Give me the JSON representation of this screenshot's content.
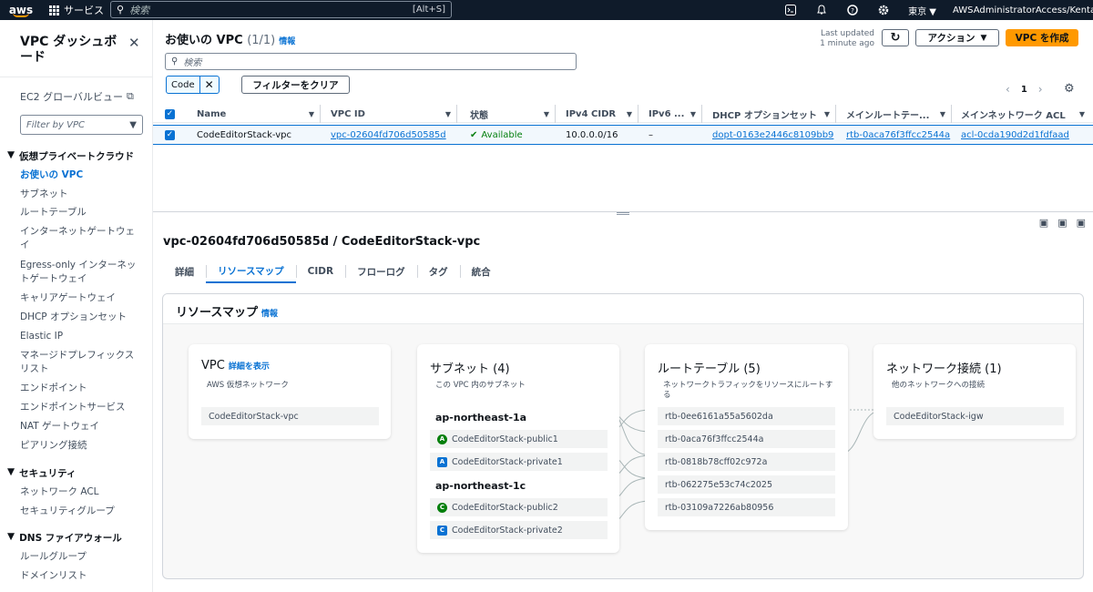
{
  "nav": {
    "logo": "aws",
    "services": "サービス",
    "search_placeholder": "検索",
    "search_shortcut": "[Alt+S]",
    "region": "東京",
    "account": "AWSAdministratorAccess/KentarouTakahashi"
  },
  "sidebar": {
    "title": "VPC ダッシュボード",
    "ec2_link": "EC2 グローバルビュー",
    "filter_placeholder": "Filter by VPC",
    "sections": [
      {
        "label": "仮想プライベートクラウド",
        "items": [
          "お使いの VPC",
          "サブネット",
          "ルートテーブル",
          "インターネットゲートウェイ",
          "Egress-only インターネットゲートウェイ",
          "キャリアゲートウェイ",
          "DHCP オプションセット",
          "Elastic IP",
          "マネージドプレフィックスリスト",
          "エンドポイント",
          "エンドポイントサービス",
          "NAT ゲートウェイ",
          "ピアリング接続"
        ]
      },
      {
        "label": "セキュリティ",
        "items": [
          "ネットワーク ACL",
          "セキュリティグループ"
        ]
      },
      {
        "label": "DNS ファイアウォール",
        "items": [
          "ルールグループ",
          "ドメインリスト"
        ]
      }
    ]
  },
  "table": {
    "title": "お使いの VPC",
    "count": "(1/1)",
    "info": "情報",
    "last_updated_label": "Last updated",
    "last_updated_value": "1 minute ago",
    "actions_label": "アクション",
    "create_label": "VPC を作成",
    "search_placeholder": "検索",
    "filter_token": "Code",
    "clear_filters": "フィルターをクリア",
    "page": "1",
    "columns": [
      "Name",
      "VPC ID",
      "状態",
      "IPv4 CIDR",
      "IPv6 ...",
      "DHCP オプションセット",
      "メインルートテー...",
      "メインネットワーク ACL"
    ],
    "row": {
      "name": "CodeEditorStack-vpc",
      "vpc_id": "vpc-02604fd706d50585d",
      "state": "Available",
      "ipv4": "10.0.0.0/16",
      "ipv6": "–",
      "dhcp": "dopt-0163e2446c8109bb9",
      "rtb": "rtb-0aca76f3ffcc2544a",
      "acl": "acl-0cda190d2d1fdfaad"
    }
  },
  "detail": {
    "title": "vpc-02604fd706d50585d / CodeEditorStack-vpc",
    "tabs": [
      "詳細",
      "リソースマップ",
      "CIDR",
      "フローログ",
      "タグ",
      "統合"
    ],
    "map_title": "リソースマップ",
    "map_info": "情報",
    "vpc": {
      "title": "VPC",
      "link": "詳細を表示",
      "sub": "AWS 仮想ネットワーク",
      "item": "CodeEditorStack-vpc"
    },
    "subnets": {
      "title": "サブネット (4)",
      "sub": "この VPC 内のサブネット",
      "az1": "ap-northeast-1a",
      "az2": "ap-northeast-1c",
      "items": [
        {
          "badge": "A",
          "name": "CodeEditorStack-public1",
          "kind": "pub"
        },
        {
          "badge": "A",
          "name": "CodeEditorStack-private1",
          "kind": "prv"
        },
        {
          "badge": "C",
          "name": "CodeEditorStack-public2",
          "kind": "pub"
        },
        {
          "badge": "C",
          "name": "CodeEditorStack-private2",
          "kind": "prv"
        }
      ]
    },
    "routes": {
      "title": "ルートテーブル (5)",
      "sub": "ネットワークトラフィックをリソースにルートする",
      "items": [
        "rtb-0ee6161a55a5602da",
        "rtb-0aca76f3ffcc2544a",
        "rtb-0818b78cff02c972a",
        "rtb-062275e53c74c2025",
        "rtb-03109a7226ab80956"
      ]
    },
    "network": {
      "title": "ネットワーク接続 (1)",
      "sub": "他のネットワークへの接続",
      "item": "CodeEditorStack-igw"
    }
  }
}
